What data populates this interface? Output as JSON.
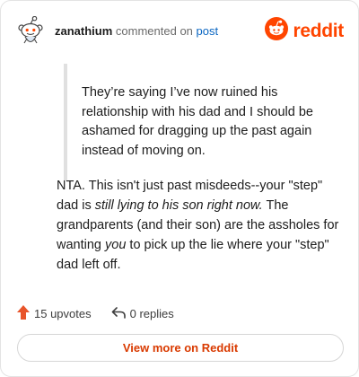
{
  "header": {
    "username": "zanathium",
    "verb": "commented on",
    "post_link": "post",
    "brand": "reddit"
  },
  "quote": {
    "text": "They’re saying I’ve now ruined his relationship with his dad and I should be ashamed for dragging up the past again instead of moving on."
  },
  "comment": {
    "p1": "NTA. This isn't just past misdeeds--your \"step\" dad is ",
    "p1_em": "still lying to his son right now.",
    "p2": " The grandparents (and their son) are the assholes for wanting ",
    "p2_em": "you",
    "p3": " to pick up the lie where your \"step\" dad left off."
  },
  "actions": {
    "upvotes": "15 upvotes",
    "replies": "0 replies"
  },
  "view_more": "View more on Reddit",
  "colors": {
    "brand": "#ff4500",
    "link": "#0a66c2",
    "view_more": "#d93a00"
  },
  "icons": {
    "avatar": "snoo-avatar-icon",
    "brand": "reddit-logo-icon",
    "upvote": "upvote-arrow-icon",
    "reply": "reply-arrow-icon"
  }
}
